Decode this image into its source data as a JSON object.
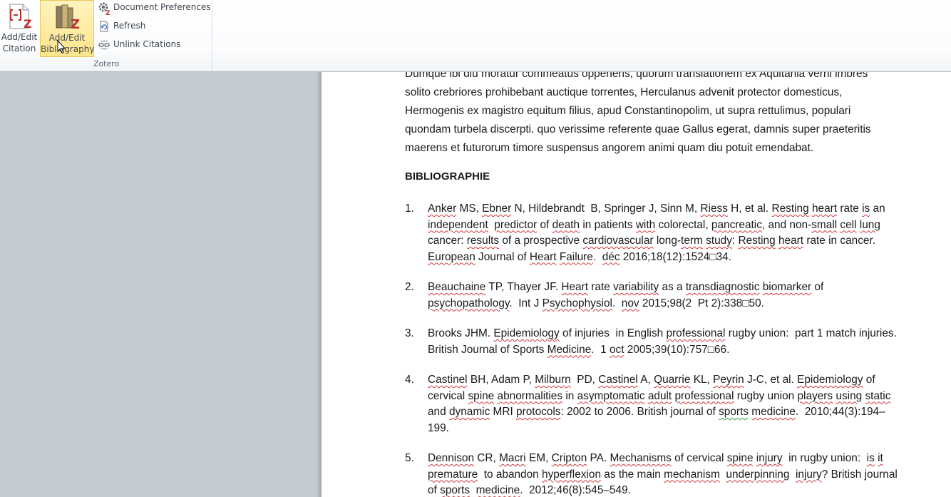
{
  "ribbon": {
    "group_label": "Zotero",
    "add_edit_citation": {
      "line1": "Add/Edit",
      "line2": "Citation",
      "icon": "citation-bracket-z-icon"
    },
    "add_edit_bibliography": {
      "line1": "Add/Edit",
      "line2": "Bibliography",
      "icon": "books-z-icon"
    },
    "document_preferences": {
      "label": "Document Preferences",
      "icon": "gear-z-icon"
    },
    "refresh": {
      "label": "Refresh",
      "icon": "refresh-document-icon"
    },
    "unlink_citations": {
      "label": "Unlink Citations",
      "icon": "broken-link-icon"
    }
  },
  "document": {
    "paragraph_lines": [
      "Dumque ibi diu moratur commeatus opperiens, quorum translationem ex Aquitania verni imbres",
      "solito crebriores prohibebant  auctique torrentes, Herculanus advenit protector domesticus,",
      "Hermogenis ex magistro equitum filius, apud Constantinopolim, ut supra rettulimus, populari",
      "quondam  turbela discerpti. quo verissime referente quae Gallus egerat, damnis super praeteritis",
      "maerens et futurorum timore suspensus angorem animi quam diu potuit emendabat."
    ],
    "heading": "BIBLIOGRAPHIE",
    "references": [
      {
        "num": "1.",
        "lines": [
          [
            {
              "t": "Anker",
              "s": "r"
            },
            {
              "t": " MS, "
            },
            {
              "t": "Ebner",
              "s": "r"
            },
            {
              "t": " N, Hildebrandt  B, Springer J, Sinn M, "
            },
            {
              "t": "Riess",
              "s": "r"
            },
            {
              "t": " H, et al. "
            },
            {
              "t": "Resting",
              "s": "r"
            },
            {
              "t": " "
            },
            {
              "t": "heart",
              "s": "r"
            },
            {
              "t": " rate "
            },
            {
              "t": "is",
              "s": "r"
            },
            {
              "t": " an"
            }
          ],
          [
            {
              "t": "independent",
              "s": "r"
            },
            {
              "t": "  "
            },
            {
              "t": "predictor",
              "s": "r"
            },
            {
              "t": " of "
            },
            {
              "t": "death",
              "s": "r"
            },
            {
              "t": " in patients "
            },
            {
              "t": "with",
              "s": "r"
            },
            {
              "t": " colorectal, "
            },
            {
              "t": "pancreatic",
              "s": "r"
            },
            {
              "t": ", and non-"
            },
            {
              "t": "small",
              "s": "r"
            },
            {
              "t": " "
            },
            {
              "t": "cell",
              "s": "r"
            },
            {
              "t": " "
            },
            {
              "t": "lung",
              "s": "r"
            }
          ],
          [
            {
              "t": "cancer: "
            },
            {
              "t": "results",
              "s": "r"
            },
            {
              "t": " of a prospective "
            },
            {
              "t": "cardiovascular",
              "s": "r"
            },
            {
              "t": " long-"
            },
            {
              "t": "term",
              "s": "r"
            },
            {
              "t": " "
            },
            {
              "t": "study",
              "s": "r"
            },
            {
              "t": ": "
            },
            {
              "t": "Resting",
              "s": "r"
            },
            {
              "t": " "
            },
            {
              "t": "heart",
              "s": "r"
            },
            {
              "t": " rate in cancer."
            }
          ],
          [
            {
              "t": "European",
              "s": "r"
            },
            {
              "t": " Journal of "
            },
            {
              "t": "Heart",
              "s": "r"
            },
            {
              "t": " "
            },
            {
              "t": "Failure",
              "s": "r"
            },
            {
              "t": ".  "
            },
            {
              "t": "déc",
              "s": "r"
            },
            {
              "t": " 2016;18(12):1524□34."
            }
          ]
        ]
      },
      {
        "num": "2.",
        "lines": [
          [
            {
              "t": "Beauchaine",
              "s": "r"
            },
            {
              "t": " TP, Thayer JF. "
            },
            {
              "t": "Heart",
              "s": "r"
            },
            {
              "t": " rate "
            },
            {
              "t": "variability",
              "s": "r"
            },
            {
              "t": " as a "
            },
            {
              "t": "transdiagnostic",
              "s": "r"
            },
            {
              "t": " "
            },
            {
              "t": "biomarker",
              "s": "r"
            },
            {
              "t": " of"
            }
          ],
          [
            {
              "t": "psychopathology",
              "s": "r"
            },
            {
              "t": ".  Int J "
            },
            {
              "t": "Psychophysiol",
              "s": "r"
            },
            {
              "t": ".  "
            },
            {
              "t": "nov",
              "s": "r"
            },
            {
              "t": " 2015;98(2  Pt 2):338□50."
            }
          ]
        ]
      },
      {
        "num": "3.",
        "lines": [
          [
            {
              "t": "Brooks JHM. "
            },
            {
              "t": "Epidemiology",
              "s": "r"
            },
            {
              "t": " of injuries  in English "
            },
            {
              "t": "professional",
              "s": "r"
            },
            {
              "t": " rugby union:  part 1 match injuries."
            }
          ],
          [
            {
              "t": "British Journal of Sports "
            },
            {
              "t": "Medicine",
              "s": "r"
            },
            {
              "t": ".  1 "
            },
            {
              "t": "oct",
              "s": "r"
            },
            {
              "t": " 2005;39(10):757□66."
            }
          ]
        ]
      },
      {
        "num": "4.",
        "lines": [
          [
            {
              "t": "Castinel",
              "s": "r"
            },
            {
              "t": " BH, Adam P, "
            },
            {
              "t": "Milburn",
              "s": "r"
            },
            {
              "t": "  PD, "
            },
            {
              "t": "Castinel",
              "s": "r"
            },
            {
              "t": " A, "
            },
            {
              "t": "Quarrie",
              "s": "r"
            },
            {
              "t": " KL, "
            },
            {
              "t": "Peyrin",
              "s": "r"
            },
            {
              "t": " J-C, et al. "
            },
            {
              "t": "Epidemiology",
              "s": "r"
            },
            {
              "t": " of"
            }
          ],
          [
            {
              "t": "cervical "
            },
            {
              "t": "spine",
              "s": "r"
            },
            {
              "t": " "
            },
            {
              "t": "abnormalities",
              "s": "r"
            },
            {
              "t": " in "
            },
            {
              "t": "asymptomatic",
              "s": "r"
            },
            {
              "t": " "
            },
            {
              "t": "adult",
              "s": "r"
            },
            {
              "t": " "
            },
            {
              "t": "professional",
              "s": "r"
            },
            {
              "t": " rugby union "
            },
            {
              "t": "players",
              "s": "r"
            },
            {
              "t": " "
            },
            {
              "t": "using",
              "s": "r"
            },
            {
              "t": " "
            },
            {
              "t": "static",
              "s": "r"
            }
          ],
          [
            {
              "t": "and "
            },
            {
              "t": "dynamic",
              "s": "r"
            },
            {
              "t": " MRI "
            },
            {
              "t": "protocols",
              "s": "r"
            },
            {
              "t": ": 2002 to 2006. British journal of "
            },
            {
              "t": "sports",
              "s": "g"
            },
            {
              "t": " "
            },
            {
              "t": "medicine",
              "s": "r"
            },
            {
              "t": ".  2010;44(3):194–"
            }
          ],
          [
            {
              "t": "199."
            }
          ]
        ]
      },
      {
        "num": "5.",
        "lines": [
          [
            {
              "t": "Dennison",
              "s": "r"
            },
            {
              "t": " CR, "
            },
            {
              "t": "Macri",
              "s": "r"
            },
            {
              "t": " EM, "
            },
            {
              "t": "Cripton",
              "s": "r"
            },
            {
              "t": " PA. "
            },
            {
              "t": "Mechanisms",
              "s": "r"
            },
            {
              "t": " of cervical "
            },
            {
              "t": "spine",
              "s": "r"
            },
            {
              "t": " "
            },
            {
              "t": "injury",
              "s": "r"
            },
            {
              "t": "  in rugby union:  "
            },
            {
              "t": "is",
              "s": "r"
            },
            {
              "t": " "
            },
            {
              "t": "it",
              "s": "r"
            }
          ],
          [
            {
              "t": "premature",
              "s": "r"
            },
            {
              "t": "  to abandon "
            },
            {
              "t": "hyperflexion",
              "s": "r"
            },
            {
              "t": " as the main "
            },
            {
              "t": "mechanism",
              "s": "r"
            },
            {
              "t": "  "
            },
            {
              "t": "underpinning",
              "s": "r"
            },
            {
              "t": "  "
            },
            {
              "t": "injury",
              "s": "r"
            },
            {
              "t": "? British journal"
            }
          ],
          [
            {
              "t": "of "
            },
            {
              "t": "sports",
              "s": "r"
            },
            {
              "t": "  "
            },
            {
              "t": "medicine",
              "s": "r"
            },
            {
              "t": ".  2012;46(8):545–549."
            }
          ]
        ]
      }
    ]
  }
}
